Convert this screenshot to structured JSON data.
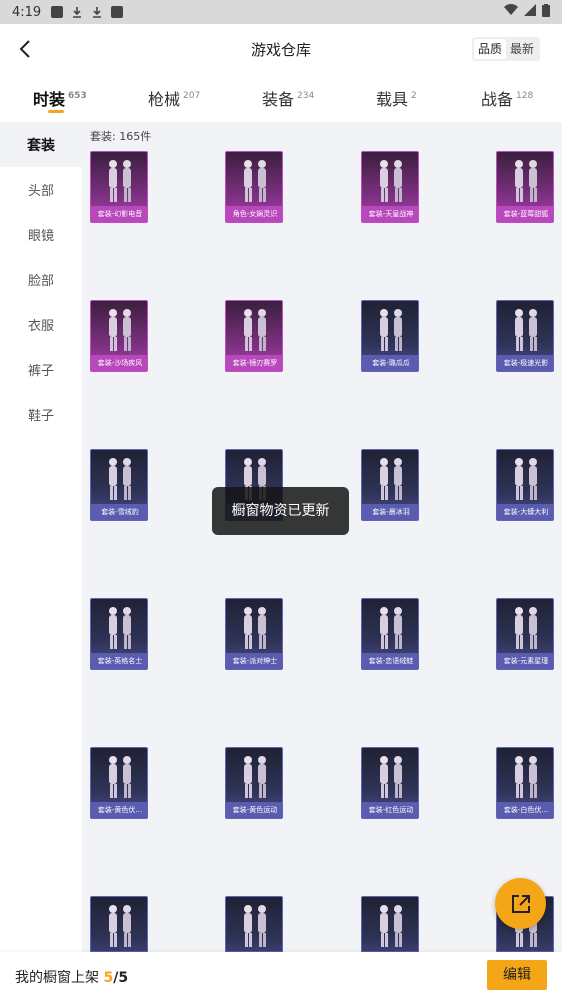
{
  "status_bar": {
    "time": "4:19"
  },
  "header": {
    "title": "游戏仓库",
    "sort_options": [
      "品质",
      "最新"
    ],
    "active_sort": "品质"
  },
  "tabs": [
    {
      "label": "时装",
      "count": "653"
    },
    {
      "label": "枪械",
      "count": "207"
    },
    {
      "label": "装备",
      "count": "234"
    },
    {
      "label": "载具",
      "count": "2"
    },
    {
      "label": "战备",
      "count": "128"
    }
  ],
  "sidebar": {
    "items": [
      "套装",
      "头部",
      "眼镜",
      "脸部",
      "衣服",
      "裤子",
      "鞋子"
    ]
  },
  "content": {
    "count_label": "套装: 165件",
    "items": [
      {
        "name": "套装-幻影电音",
        "rarity": "purple"
      },
      {
        "name": "角色-女娲灵识",
        "rarity": "purple"
      },
      {
        "name": "套装-天皇战神",
        "rarity": "purple"
      },
      {
        "name": "套装-蓝莓甜狐",
        "rarity": "purple"
      },
      {
        "name": "套装-沙场疾风",
        "rarity": "purple"
      },
      {
        "name": "套装-镜刃赛罗",
        "rarity": "purple"
      },
      {
        "name": "套装-璐瓜瓜",
        "rarity": "blue"
      },
      {
        "name": "套装-极速光影",
        "rarity": "blue"
      },
      {
        "name": "套装-雪绒豹",
        "rarity": "blue"
      },
      {
        "name": "套装-舞会",
        "rarity": "blue"
      },
      {
        "name": "套装-晨冰羽",
        "rarity": "blue"
      },
      {
        "name": "套装-大蟒大利",
        "rarity": "blue"
      },
      {
        "name": "套装-英格名士",
        "rarity": "blue"
      },
      {
        "name": "套装-派对绅士",
        "rarity": "blue"
      },
      {
        "name": "套装-恋语绒蛙",
        "rarity": "blue"
      },
      {
        "name": "套装-元素星瑾",
        "rarity": "blue"
      },
      {
        "name": "套装-黄色伏...",
        "rarity": "blue"
      },
      {
        "name": "套装-黄色运动",
        "rarity": "blue"
      },
      {
        "name": "套装-红色运动",
        "rarity": "blue"
      },
      {
        "name": "套装-白色伏...",
        "rarity": "blue"
      },
      {
        "name": "",
        "rarity": "blue"
      },
      {
        "name": "",
        "rarity": "blue"
      },
      {
        "name": "",
        "rarity": "blue"
      },
      {
        "name": "",
        "rarity": "blue"
      }
    ]
  },
  "toast": "橱窗物资已更新",
  "bottom_bar": {
    "label": "我的橱窗上架",
    "current": "5",
    "separator": "/",
    "total": "5",
    "edit_button": "编辑"
  },
  "colors": {
    "accent": "#f5a616",
    "purple_rarity": "#b848bb",
    "blue_rarity": "#5a5cb0"
  }
}
